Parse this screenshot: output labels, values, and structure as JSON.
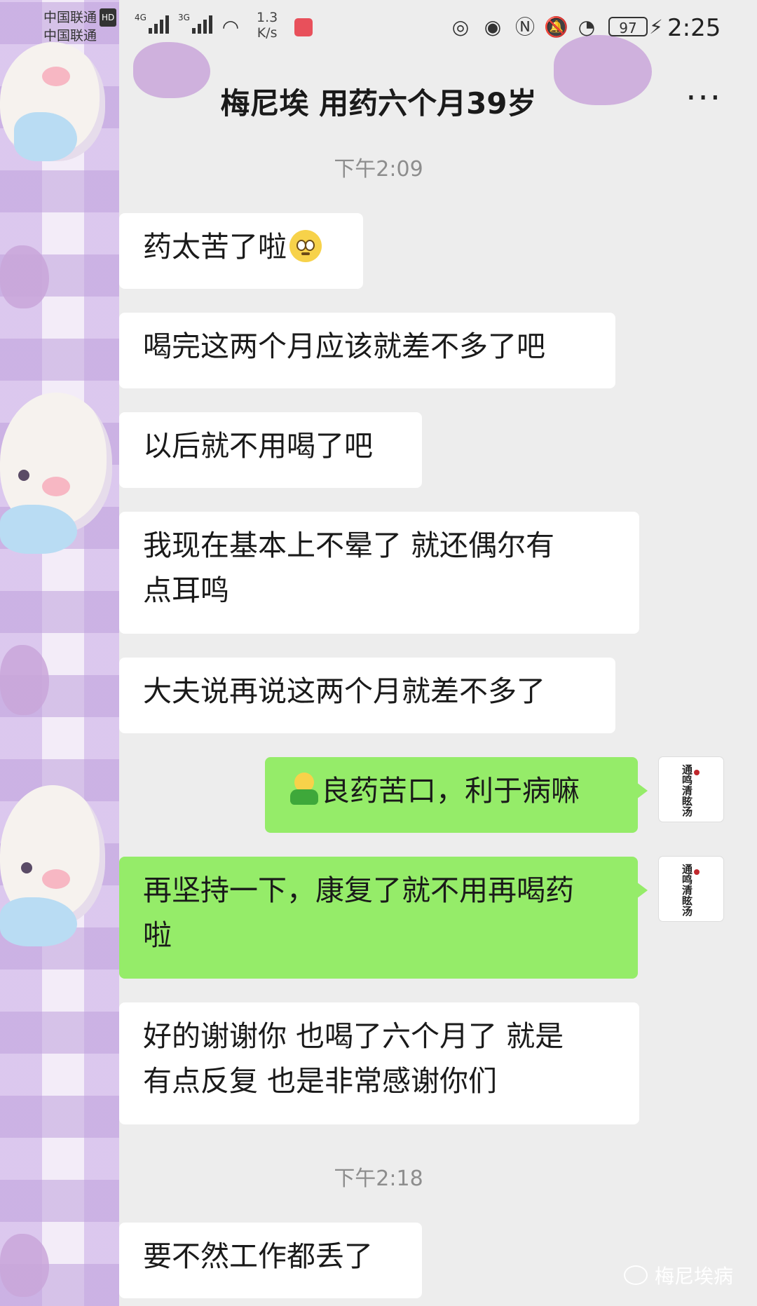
{
  "status_bar": {
    "carrier_1": "中国联通",
    "carrier_badge": "HD",
    "carrier_2": "中国联通",
    "net_1": "4G",
    "net_2": "3G",
    "speed_value": "1.3",
    "speed_unit": "K/s",
    "battery": "97",
    "time": "2:25"
  },
  "header": {
    "title": "梅尼埃 用药六个月39岁",
    "more": "···"
  },
  "messages": [
    {
      "type": "timestamp",
      "text": "下午2:09"
    },
    {
      "type": "received",
      "text": "药太苦了啦"
    },
    {
      "type": "received",
      "text": "喝完这两个月应该就差不多了吧"
    },
    {
      "type": "received",
      "text": "以后就不用喝了吧"
    },
    {
      "type": "received",
      "line1": "我现在基本上不晕了 就还偶尔有",
      "line2": "点耳鸣"
    },
    {
      "type": "received",
      "text": "大夫说再说这两个月就差不多了"
    },
    {
      "type": "sent",
      "text": "良药苦口，利于病嘛"
    },
    {
      "type": "sent",
      "line1": "再坚持一下，康复了就不用再喝药",
      "line2": "啦"
    },
    {
      "type": "received",
      "line1": "好的谢谢你 也喝了六个月了 就是",
      "line2": "有点反复 也是非常感谢你们"
    },
    {
      "type": "timestamp",
      "text": "下午2:18"
    },
    {
      "type": "received",
      "text": "要不然工作都丢了"
    }
  ],
  "avatar": {
    "calligraphy": "通鸣清眩汤"
  },
  "watermark": "梅尼埃病",
  "colors": {
    "sent_bubble": "#95ec69",
    "received_bubble": "#ffffff",
    "background": "#ededed"
  }
}
